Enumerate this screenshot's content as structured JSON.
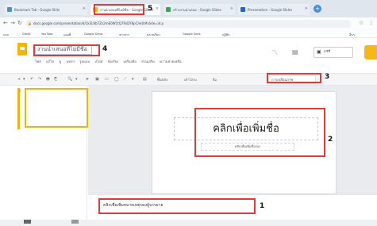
{
  "browser": {
    "tabs": [
      {
        "title": "Bookmark Tab - Google Slide",
        "color": "#4a8fd6"
      },
      {
        "title": "งานนำเสนอที่ไม่มีชื่อ - Google Slides",
        "color": "#f4b400"
      },
      {
        "title": "สร้างงานนำเสนอ - Google Slides",
        "color": "#34a853"
      },
      {
        "title": "Presentation - Google Slides",
        "color": "#1967d2"
      }
    ],
    "new_tab": "+",
    "url": "docs.google.com/presentation/d/1k3L9b7Zx2mE0W1tQ7RsDY8pC/edit#slide=id.p"
  },
  "bookmarks": [
    "แอป",
    "Gmail",
    "YouTube",
    "แผนที่",
    "Google Drive",
    "ข่าวสาร",
    "คลาสเรียน",
    "Google Docs",
    "ปฏิทิน",
    "อื่นๆ"
  ],
  "app": {
    "title": "งานนำเสนอที่ไม่มีชื่อ",
    "menus": [
      "ไฟล์",
      "แก้ไข",
      "ดู",
      "แทรก",
      "รูปแบบ",
      "สไลด์",
      "จัดเรียง",
      "เครื่องมือ",
      "ส่วนเสริม",
      "ความช่วยเหลือ"
    ],
    "share_label": "แชร์",
    "avatar_color": "#f6b71a",
    "accent": "#f4b400"
  },
  "toolbar": {
    "items": [
      "+",
      "▾",
      "↶",
      "↷",
      "🖶",
      "⎘",
      "🔍",
      "▾",
      "➤",
      "▣",
      "▭",
      "◯",
      "⟋",
      "▾",
      "▤",
      "พื้นหลัง",
      "เค้าโครง",
      "ธีม"
    ],
    "layout_label": "การเปลี่ยนภาพ"
  },
  "slide": {
    "number": "1",
    "title_placeholder": "คลิกเพื่อเพิ่มชื่อ",
    "subtitle_placeholder": "คลิกเพื่อเพิ่มชื่อรอง"
  },
  "notes": {
    "placeholder": "คลิกเพื่อเพิ่มหมายเหตุของผู้บรรยาย"
  },
  "callouts": {
    "one": "1",
    "two": "2",
    "three": "3",
    "four": "4",
    "five": "5",
    "color": "#e53935"
  }
}
